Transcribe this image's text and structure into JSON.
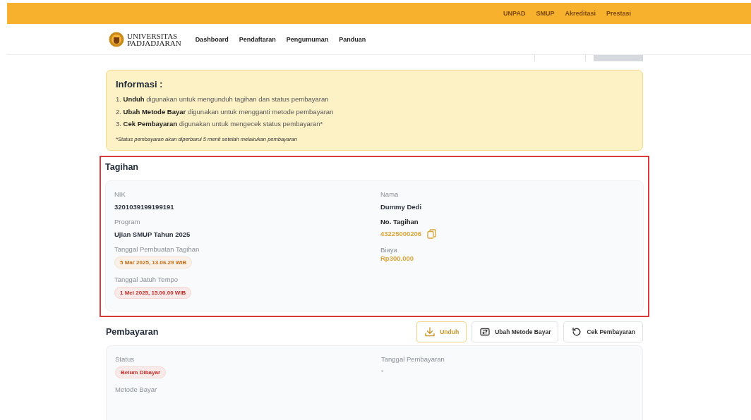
{
  "top_links": [
    "UNPAD",
    "SMUP",
    "Akreditasi",
    "Prestasi"
  ],
  "logo": {
    "line1": "UNIVERSITAS",
    "line2": "PADJADJARAN"
  },
  "nav": [
    "Dashboard",
    "Pendaftaran",
    "Pengumuman",
    "Panduan"
  ],
  "info": {
    "title": "Informasi :",
    "items": [
      "1. **Unduh** digunakan untuk mengunduh tagihan dan status pembayaran",
      "2. **Ubah Metode Bayar** digunakan untuk mengganti metode pembayaran",
      "3. **Cek Pembayaran** digunakan untuk mengecek status pembayaran*"
    ],
    "note": "*Status pembayaran akan diperbarui 5 menit setelah melakukan pembayaran"
  },
  "tagihan": {
    "title": "Tagihan",
    "highlighted": true,
    "columns": [
      [
        {
          "kind": "text",
          "label": "NIK",
          "value": "3201039199199191"
        },
        {
          "kind": "text",
          "label": "Program",
          "value": "Ujian SMUP Tahun 2025"
        },
        {
          "kind": "badge",
          "color": "#c46f18",
          "label": "Tanggal Pembuatan Tagihan",
          "value": "5 Mar 2025, 13.06.29 WIB"
        },
        {
          "kind": "badge",
          "color": "#c0302a",
          "label": "Tanggal Jatuh Tempo",
          "value": "1 Mei 2025, 15.00.00 WIB"
        }
      ],
      [
        {
          "kind": "text",
          "label": "Nama",
          "value": "Dummy Dedi"
        },
        {
          "kind": "copyable",
          "label": "No. Tagihan",
          "value": "43225000206"
        },
        {
          "kind": "accent",
          "label": "Biaya",
          "value": "Rp300.000"
        }
      ]
    ]
  },
  "pembayaran": {
    "title": "Pembayaran",
    "buttons": [
      {
        "kind": "download",
        "label": "Unduh",
        "highlighted": true
      },
      {
        "kind": "swap",
        "label": "Ubah Metode Bayar",
        "highlighted": false
      },
      {
        "kind": "refresh",
        "label": "Cek Pembayaran",
        "highlighted": false
      }
    ],
    "columns": [
      [
        {
          "kind": "badge",
          "color": "#c0302a",
          "label": "Status",
          "value": "Belum Dibayar"
        },
        {
          "kind": "label_only",
          "label": "Metode Bayar"
        }
      ],
      [
        {
          "kind": "text_plain",
          "label": "Tanggal Pembayaran",
          "value": "-"
        }
      ]
    ]
  }
}
